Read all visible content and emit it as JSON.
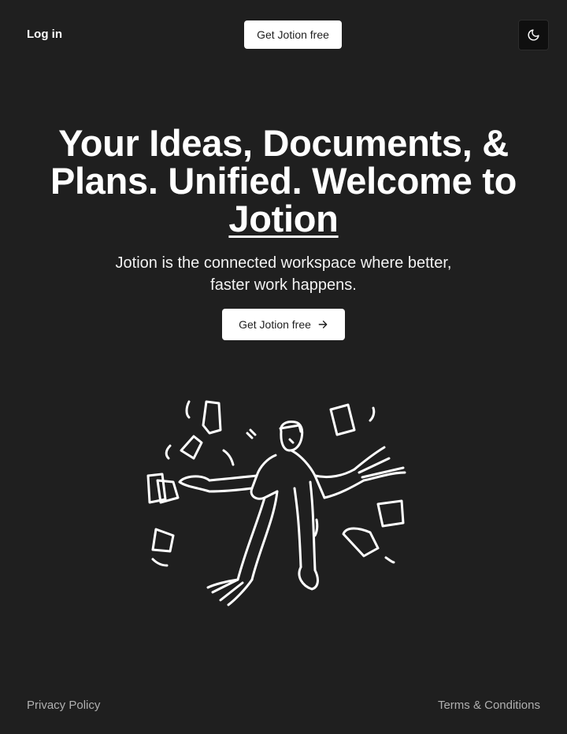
{
  "header": {
    "login_label": "Log in",
    "cta_label": "Get Jotion free",
    "theme_icon": "moon-icon"
  },
  "hero": {
    "title_prefix": "Your Ideas, Documents, & Plans. Unified. Welcome to ",
    "title_brand": "Jotion",
    "subtitle": "Jotion is the connected workspace where better, faster work happens.",
    "cta_label": "Get Jotion free",
    "cta_icon": "arrow-right-icon"
  },
  "footer": {
    "privacy_label": "Privacy Policy",
    "terms_label": "Terms & Conditions"
  },
  "colors": {
    "background": "#1f1f1f",
    "button_bg": "#ffffff",
    "text": "#ffffff",
    "footer_text": "#b0b0b0"
  }
}
